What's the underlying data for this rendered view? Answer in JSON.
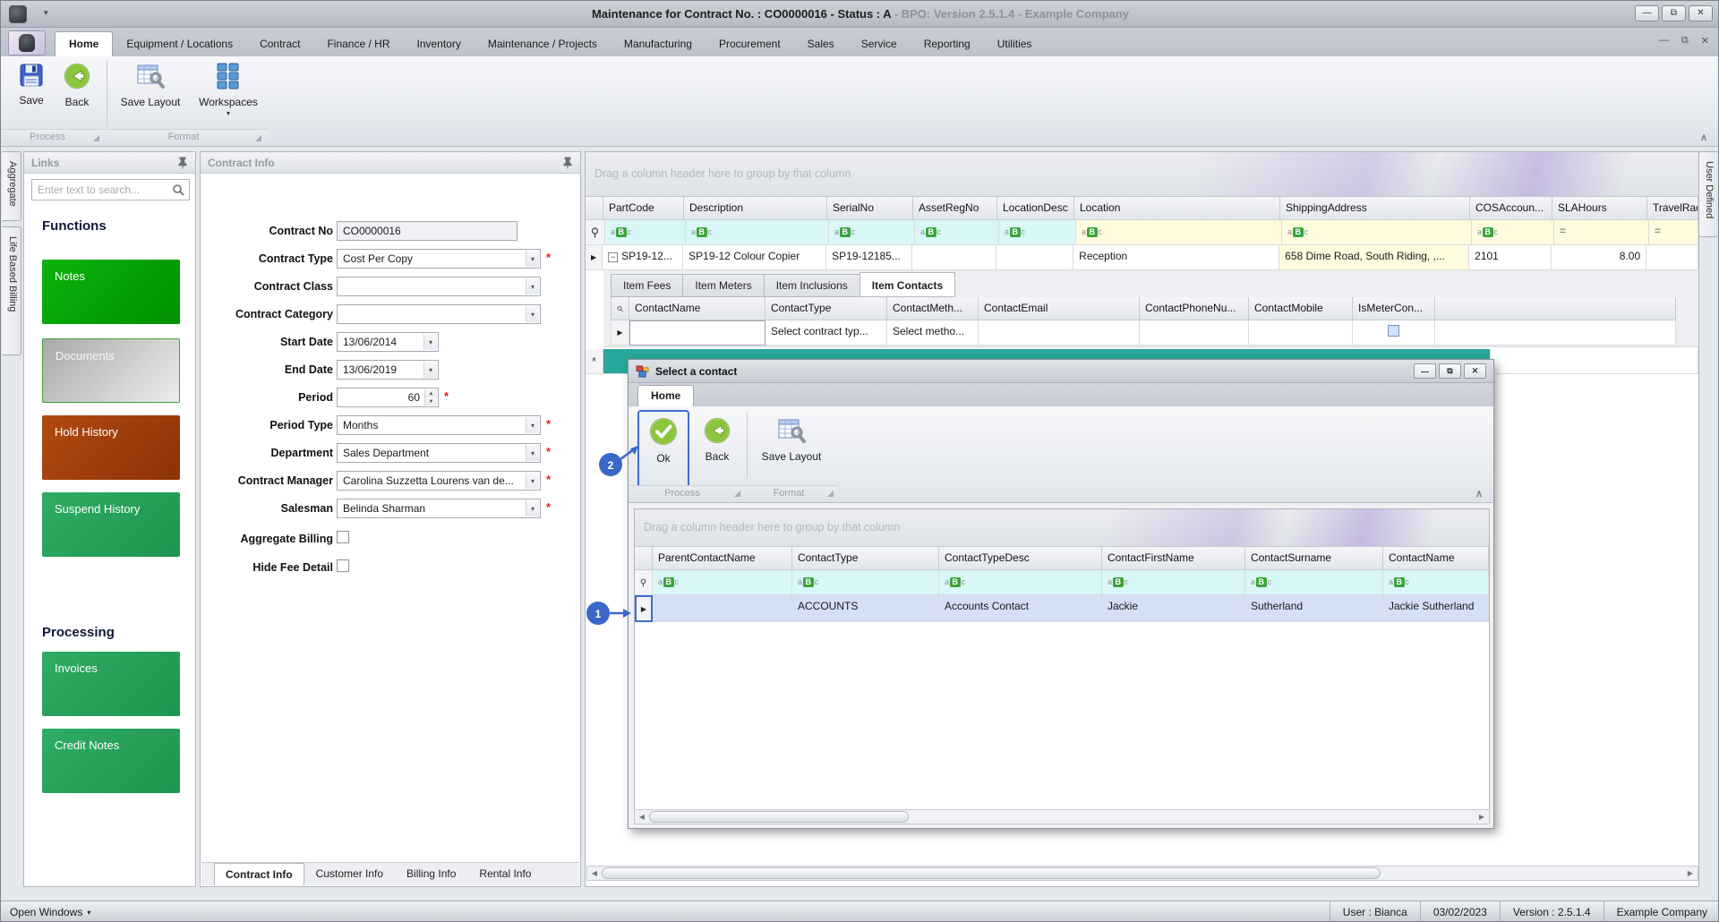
{
  "icons": {
    "asterisk": "*",
    "caret_down": "▾",
    "minimize": "—",
    "restore": "⧉",
    "close": "✕",
    "row_arrow": "▶",
    "expand_minus": "−",
    "new_row_star": "*",
    "scroll_left": "◀",
    "scroll_right": "▶",
    "equals": "=",
    "abc_a": "a",
    "abc_b": "B",
    "abc_c": "c",
    "chevron_collapse": "∧",
    "spin_up": "▲",
    "spin_down": "▼"
  },
  "window": {
    "title_main": "Maintenance for Contract No. : CO0000016 - Status : A",
    "title_dim": " - BPO: Version 2.5.1.4 - Example Company"
  },
  "ribbon": {
    "tabs": [
      "Home",
      "Equipment / Locations",
      "Contract",
      "Finance / HR",
      "Inventory",
      "Maintenance / Projects",
      "Manufacturing",
      "Procurement",
      "Sales",
      "Service",
      "Reporting",
      "Utilities"
    ],
    "save": "Save",
    "back": "Back",
    "save_layout": "Save Layout",
    "workspaces": "Workspaces",
    "group_process": "Process",
    "group_format": "Format"
  },
  "side_tabs": {
    "aggregate": "Aggregate",
    "life_based_billing": "Life Based Billing",
    "user_defined": "User Defined"
  },
  "links": {
    "title": "Links",
    "search_placeholder": "Enter text to search...",
    "functions_heading": "Functions",
    "processing_heading": "Processing",
    "notes": "Notes",
    "documents": "Documents",
    "hold_history": "Hold History",
    "suspend_history": "Suspend History",
    "invoices": "Invoices",
    "credit_notes": "Credit Notes"
  },
  "contract": {
    "title": "Contract Info",
    "labels": {
      "contract_no": "Contract No",
      "contract_type": "Contract Type",
      "contract_class": "Contract Class",
      "contract_category": "Contract Category",
      "start_date": "Start Date",
      "end_date": "End Date",
      "period": "Period",
      "period_type": "Period Type",
      "department": "Department",
      "contract_manager": "Contract Manager",
      "salesman": "Salesman",
      "aggregate_billing": "Aggregate Billing",
      "hide_fee_detail": "Hide Fee Detail"
    },
    "values": {
      "contract_no": "CO0000016",
      "contract_type": "Cost Per Copy",
      "contract_class": "",
      "contract_category": "",
      "start_date": "13/06/2014",
      "end_date": "13/06/2019",
      "period": "60",
      "period_type": "Months",
      "department": "Sales Department",
      "contract_manager": "Carolina Suzzetta Lourens van de...",
      "salesman": "Belinda Sharman"
    },
    "tabs": [
      "Contract Info",
      "Customer Info",
      "Billing Info",
      "Rental Info"
    ]
  },
  "equipment_grid": {
    "group_hint": "Drag a column header here to group by that column",
    "columns": [
      "PartCode",
      "Description",
      "SerialNo",
      "AssetRegNo",
      "LocationDesc",
      "Location",
      "ShippingAddress",
      "COSAccoun...",
      "SLAHours",
      "TravelRadiu..."
    ],
    "row": [
      "SP19-12...",
      "SP19-12 Colour Copier",
      "SP19-12185...",
      "",
      "",
      "Reception",
      "658 Dime Road, South Riding, ,...",
      "2101",
      "8.00",
      ""
    ]
  },
  "item_tabs": [
    "Item Fees",
    "Item Meters",
    "Item Inclusions",
    "Item Contacts"
  ],
  "item_grid": {
    "columns": [
      "ContactName",
      "ContactType",
      "ContactMeth...",
      "ContactEmail",
      "ContactPhoneNu...",
      "ContactMobile",
      "IsMeterCon..."
    ],
    "new_row": {
      "contact_type": "Select contract typ...",
      "contact_method": "Select metho..."
    }
  },
  "dialog": {
    "title": "Select a contact",
    "tab": "Home",
    "ok": "Ok",
    "back": "Back",
    "save_layout": "Save Layout",
    "group_process": "Process",
    "group_format": "Format",
    "group_hint": "Drag a column header here to group by that column",
    "columns": [
      "ParentContactName",
      "ContactType",
      "ContactTypeDesc",
      "ContactFirstName",
      "ContactSurname",
      "ContactName"
    ],
    "row": [
      "",
      "ACCOUNTS",
      "Accounts Contact",
      "Jackie",
      "Sutherland",
      "Jackie Sutherland"
    ]
  },
  "callouts": {
    "one": "1",
    "two": "2"
  },
  "status": {
    "open_windows": "Open Windows",
    "user": "User : Bianca",
    "date": "03/02/2023",
    "version": "Version : 2.5.1.4",
    "company": "Example Company"
  }
}
